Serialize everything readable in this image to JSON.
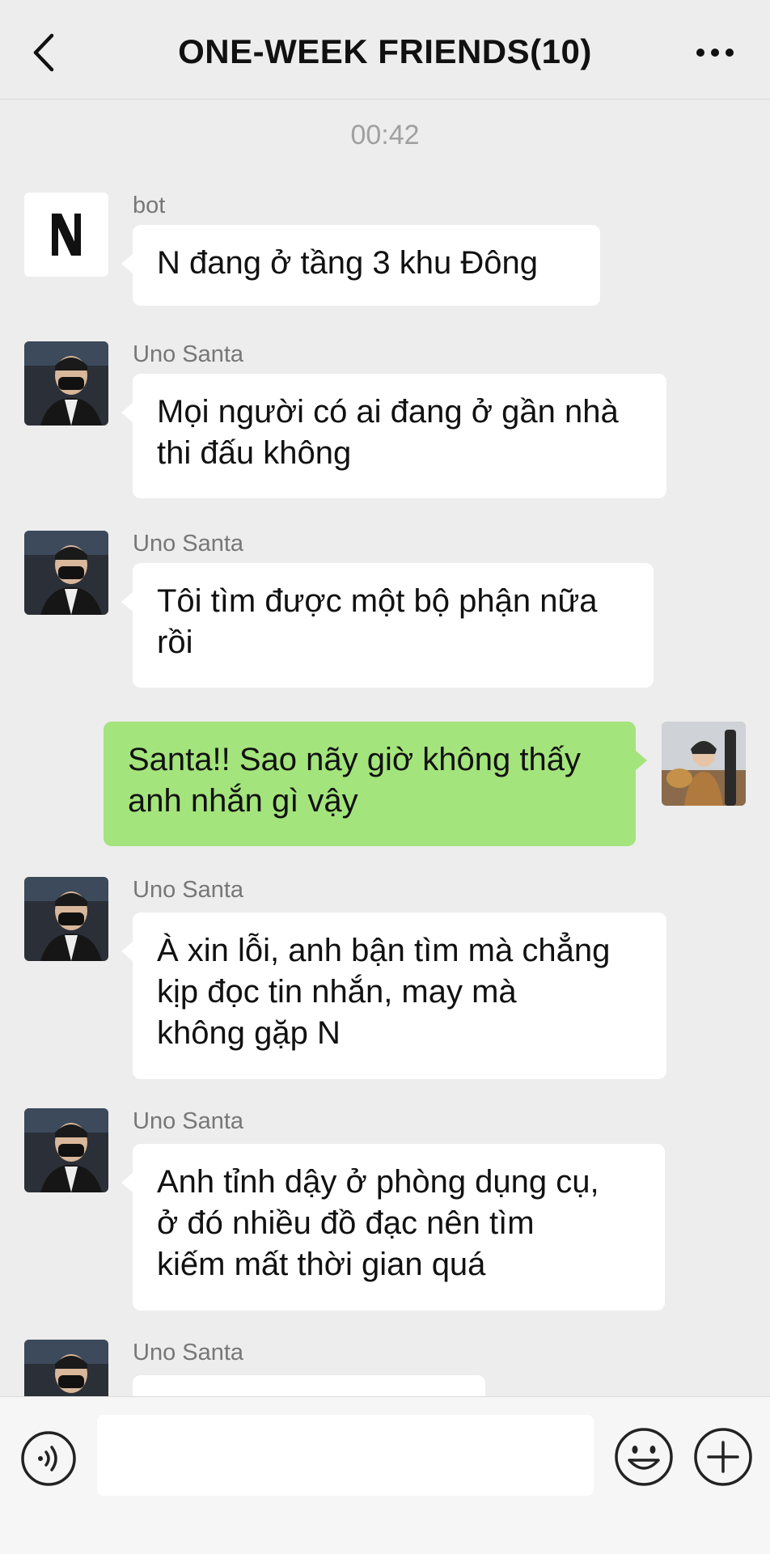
{
  "header": {
    "title": "ONE-WEEK FRIENDS(10)",
    "back_icon": "chevron-left-icon",
    "more_icon": "more-dots-icon"
  },
  "timestamp": "00:42",
  "messages": [
    {
      "sender": "bot",
      "text": "N đang ở tầng 3 khu Đông",
      "side": "left",
      "avatar": "bot-logo"
    },
    {
      "sender": "Uno Santa",
      "text": "Mọi người có ai đang ở gần nhà\nthi đấu không",
      "side": "left",
      "avatar": "uno-santa"
    },
    {
      "sender": "Uno Santa",
      "text": "Tôi tìm được một bộ phận nữa\nrồi",
      "side": "left",
      "avatar": "uno-santa"
    },
    {
      "sender": "",
      "text": "Santa!! Sao nãy giờ không thấy\nanh nhắn gì vậy",
      "side": "right",
      "avatar": "self"
    },
    {
      "sender": "Uno Santa",
      "text": "À xin lỗi, anh bận tìm mà chẳng\nkịp đọc tin nhắn, may mà\nkhông gặp N",
      "side": "left",
      "avatar": "uno-santa"
    },
    {
      "sender": "Uno Santa",
      "text": "Anh tỉnh dậy ở phòng dụng cụ,\nở đó nhiều đồ đạc nên tìm\nkiếm mất thời gian quá",
      "side": "left",
      "avatar": "uno-santa"
    },
    {
      "sender": "Uno Santa",
      "text": "",
      "side": "left",
      "avatar": "uno-santa"
    }
  ],
  "bot_logo_letter": "N",
  "input": {
    "value": "",
    "voice_icon": "voice-icon",
    "emoji_icon": "emoji-icon",
    "plus_icon": "plus-icon"
  },
  "colors": {
    "background": "#ededed",
    "bubble_left": "#ffffff",
    "bubble_right": "#a4e47c"
  }
}
